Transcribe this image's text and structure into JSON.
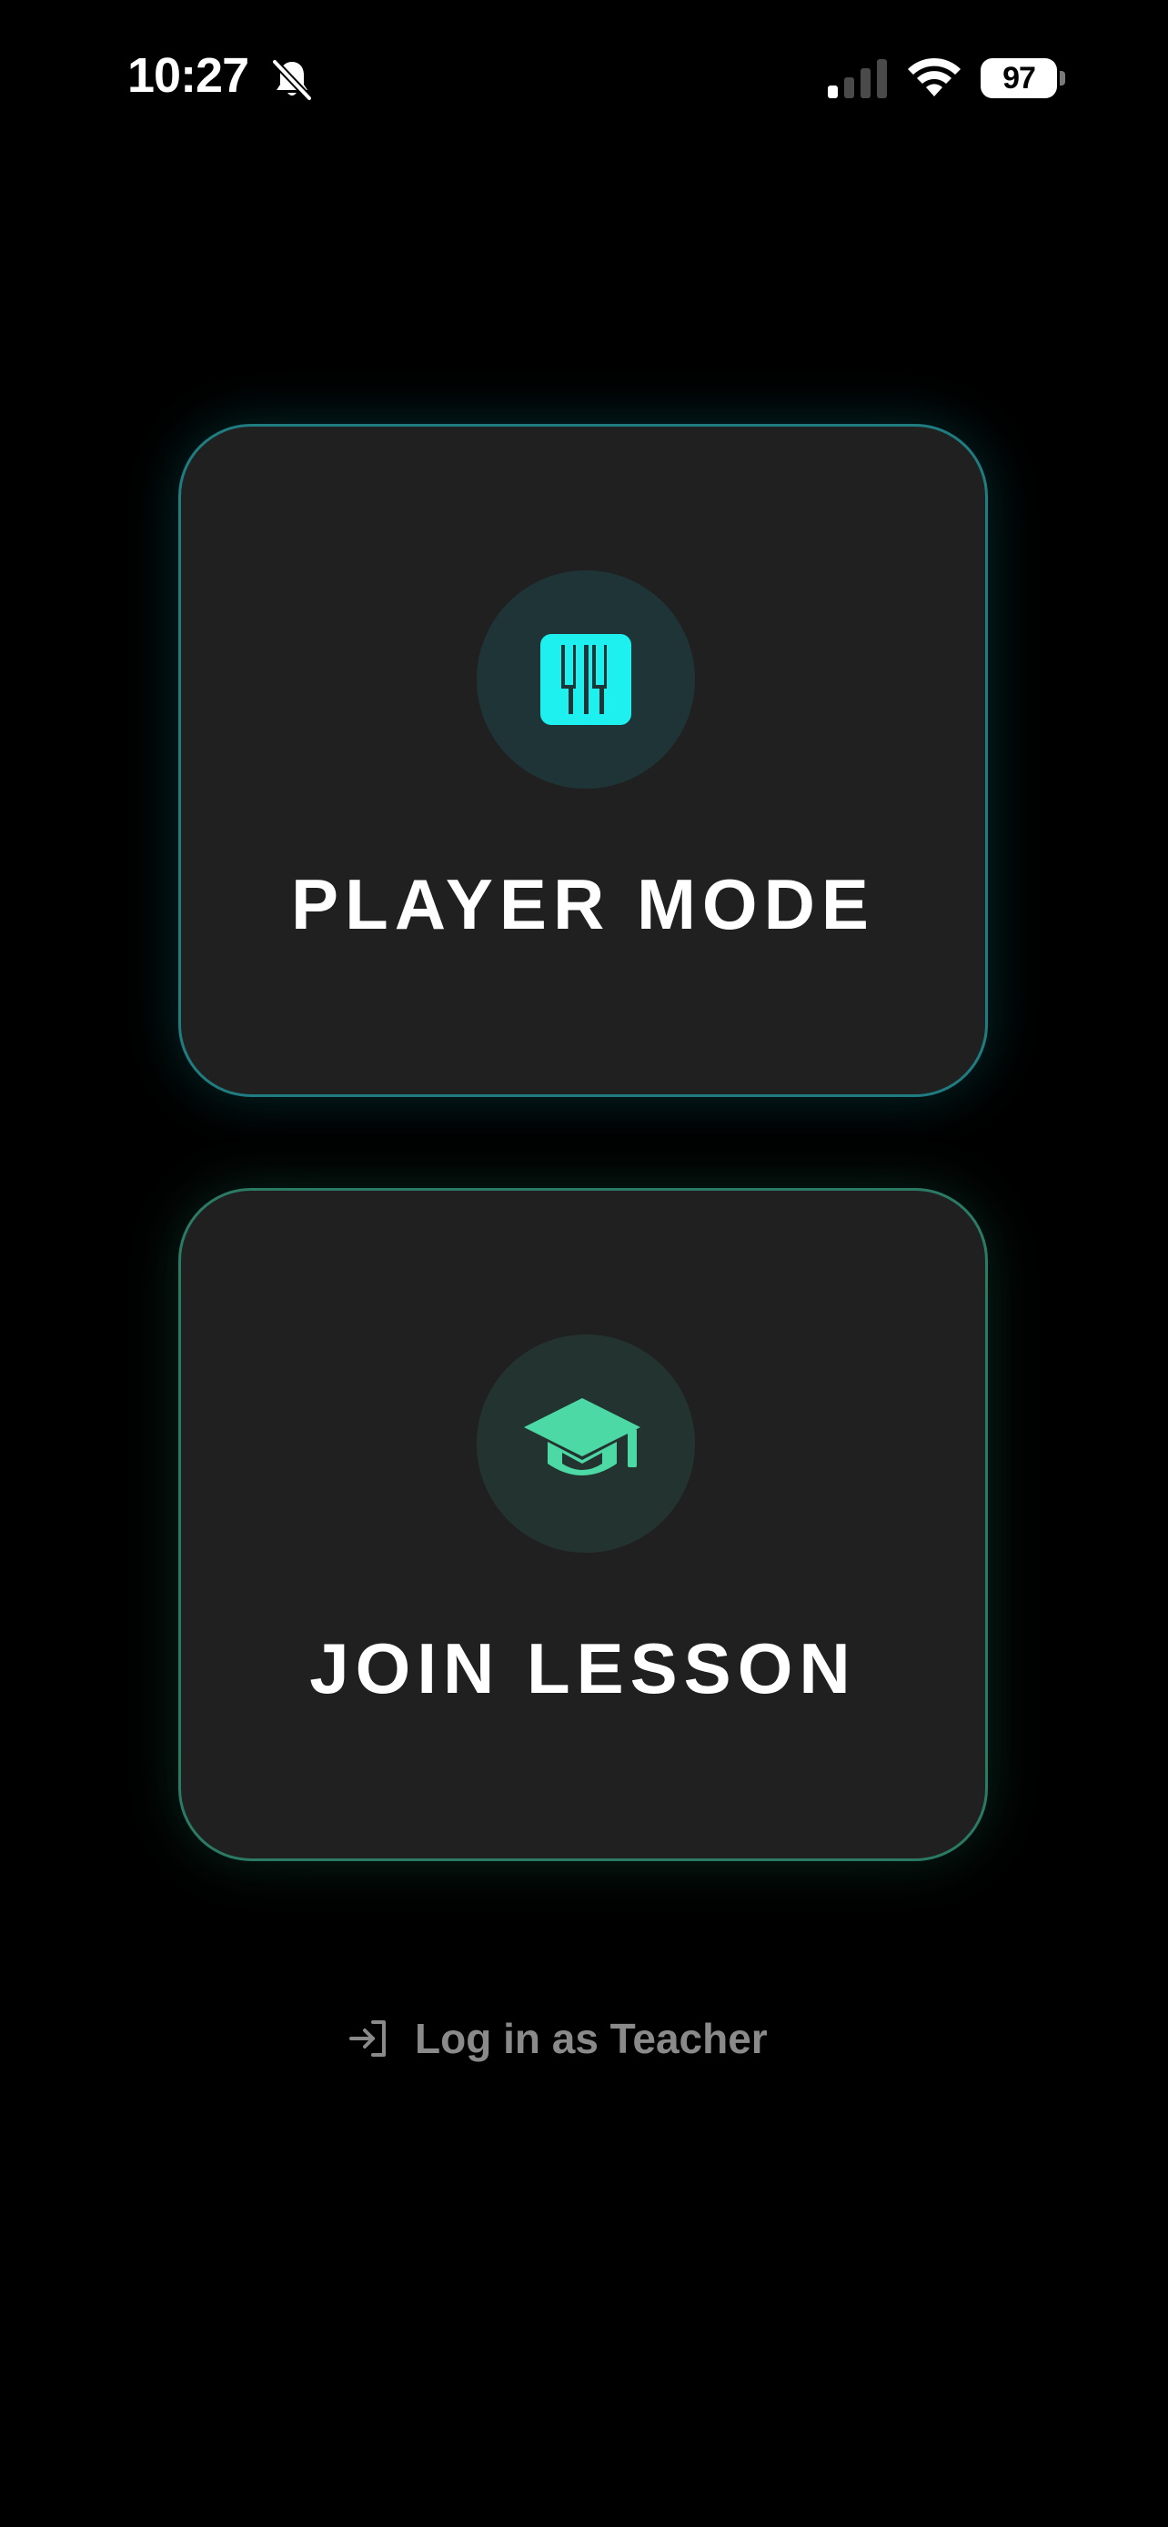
{
  "status_bar": {
    "time": "10:27",
    "battery_level": "97",
    "icons": [
      "bell-slash-icon",
      "cellular-signal-icon",
      "wifi-icon",
      "battery-icon"
    ]
  },
  "modes": [
    {
      "label": "PLAYER MODE",
      "icon": "piano-keys-icon",
      "accent_color": "#1ef0f0"
    },
    {
      "label": "JOIN LESSON",
      "icon": "graduation-cap-icon",
      "accent_color": "#4dd9a6"
    }
  ],
  "teacher_login": {
    "label": "Log in as Teacher",
    "icon": "login-arrow-icon",
    "color": "#8a8a8a"
  },
  "colors": {
    "background": "#000000",
    "card": "#202020"
  }
}
